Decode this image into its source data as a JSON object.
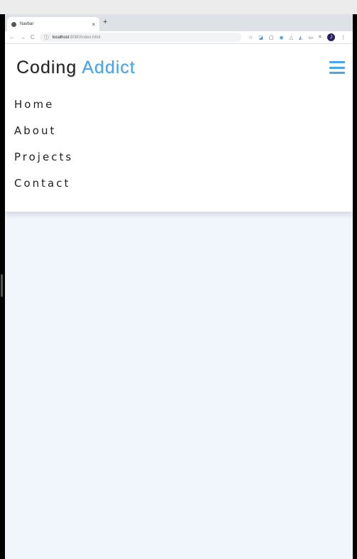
{
  "browser": {
    "tab_title": "Navbar",
    "tab_close": "×",
    "new_tab": "+",
    "url_host": "localhost",
    "url_path": ":8080/index.html",
    "profile_initial": "J"
  },
  "brand": {
    "name_part1": "Coding",
    "name_part2": "Addict",
    "accent_color": "#49a6e9"
  },
  "nav": {
    "links": [
      {
        "label": "Home"
      },
      {
        "label": "About"
      },
      {
        "label": "Projects"
      },
      {
        "label": "Contact"
      }
    ]
  },
  "icons": {
    "menu": "hamburger-icon"
  }
}
